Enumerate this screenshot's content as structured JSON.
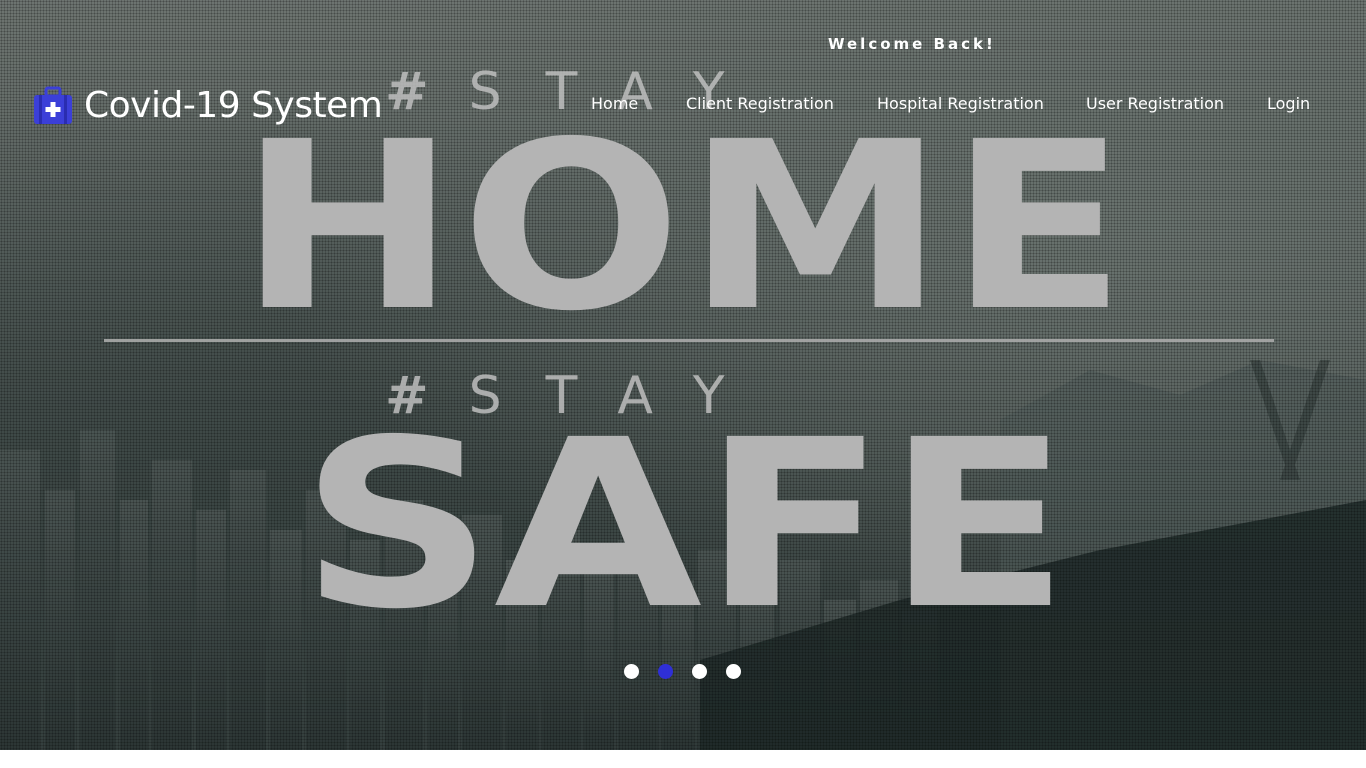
{
  "header": {
    "welcome_text": "Welcome Back!",
    "brand_title": "Covid-19 System",
    "brand_icon": "medical-kit-icon",
    "brand_icon_color": "#3b3fd8"
  },
  "nav": {
    "items": [
      {
        "label": "Home"
      },
      {
        "label": "Client Registration"
      },
      {
        "label": "Hospital Registration"
      },
      {
        "label": "User Registration"
      },
      {
        "label": "Login"
      }
    ]
  },
  "hero": {
    "line1_hash": "#",
    "line1_word": "STAY",
    "line1_big": "HOME",
    "line2_hash": "#",
    "line2_word": "STAY",
    "line2_big": "SAFE"
  },
  "carousel": {
    "slide_count": 4,
    "active_index": 1,
    "active_color": "#2f2fd6",
    "inactive_color": "#ffffff"
  }
}
